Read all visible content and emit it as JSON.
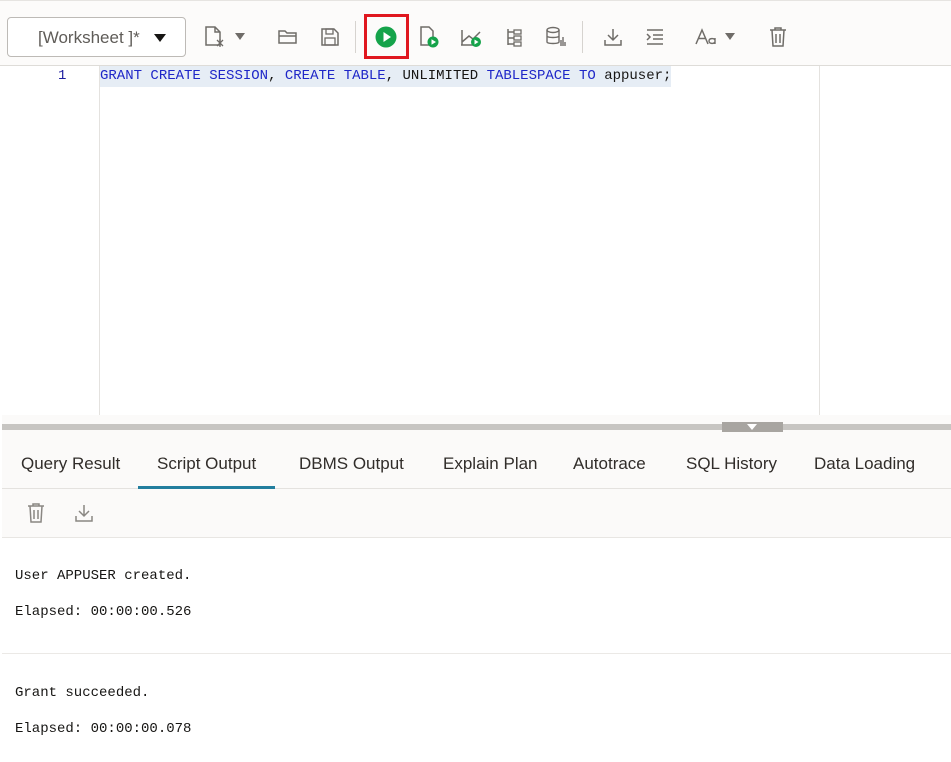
{
  "toolbar": {
    "worksheet_label": "[Worksheet ]*",
    "buttons": [
      "new-file",
      "open",
      "save",
      "run-statement",
      "run-script",
      "explain-plan",
      "autotrace",
      "sql-tuning-advisor",
      "download",
      "format",
      "font-size",
      "clear"
    ],
    "run_highlight_color": "#e0171f"
  },
  "editor": {
    "line_number": "1",
    "tokens": {
      "t1": "GRANT",
      "t2": " ",
      "t3": "CREATE",
      "t4": " ",
      "t5": "SESSION",
      "t6": ", ",
      "t7": "CREATE",
      "t8": " ",
      "t9": "TABLE",
      "t10": ", ",
      "t11": "UNLIMITED",
      "t12": " ",
      "t13": "TABLESPACE",
      "t14": " ",
      "t15": "TO",
      "t16": " appuser;"
    },
    "keyword_color": "#1e26c8"
  },
  "tabs": {
    "query_result": "Query Result",
    "script_output": "Script Output",
    "dbms_output": "DBMS Output",
    "explain_plan": "Explain Plan",
    "autotrace": "Autotrace",
    "sql_history": "SQL History",
    "data_loading": "Data Loading",
    "active": "Script Output",
    "active_color": "#227e9e"
  },
  "output": {
    "line1": "User APPUSER created.",
    "line2": "Elapsed: 00:00:00.526",
    "line3": "Grant succeeded.",
    "line4": "Elapsed: 00:00:00.078"
  }
}
